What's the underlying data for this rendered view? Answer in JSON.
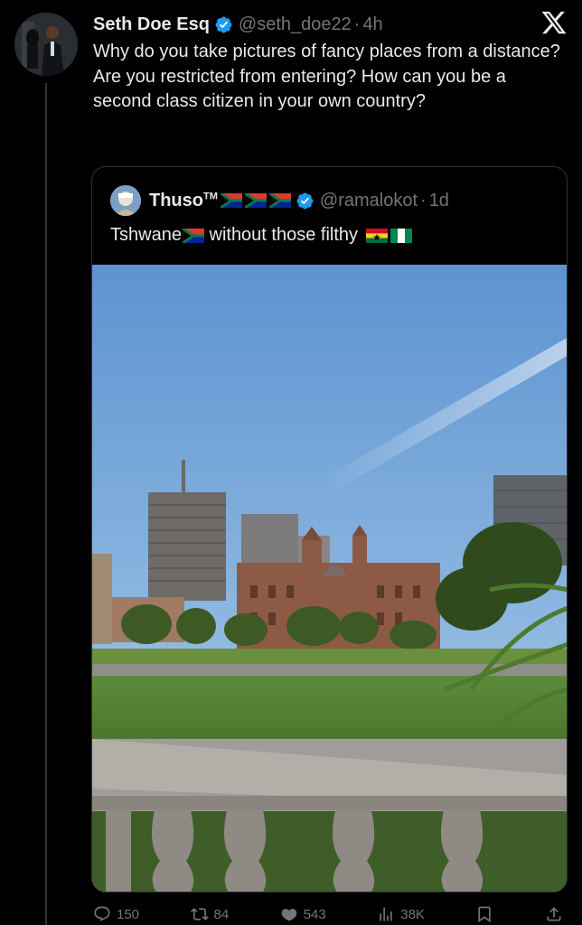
{
  "tweet": {
    "author_name": "Seth Doe Esq",
    "handle": "@seth_doe22",
    "separator": "·",
    "time": "4h",
    "text": "Why do you take pictures of fancy places from a distance? Are you restricted from entering? How can you be a second class citizen in your own country?"
  },
  "quote": {
    "author_name": "Thuso",
    "trademark": "TM",
    "handle": "@ramalokot",
    "separator": "·",
    "time": "1d",
    "text_before": "Tshwane",
    "text_middle": " without those filthy ",
    "flags_in_name": [
      "south-africa-flag",
      "south-africa-flag",
      "south-africa-flag"
    ],
    "flags_in_text": [
      "south-africa-flag",
      "ghana-flag",
      "nigeria-flag"
    ]
  },
  "actions": {
    "replies": "150",
    "reposts": "84",
    "likes": "543",
    "views": "38K"
  },
  "icons": {
    "verified": "verified-badge-icon",
    "logo": "x-logo-icon"
  },
  "colors": {
    "background": "#000000",
    "text": "#e7e9ea",
    "secondary": "#71767b",
    "verified": "#1d9bf0",
    "border": "#2f3336"
  }
}
